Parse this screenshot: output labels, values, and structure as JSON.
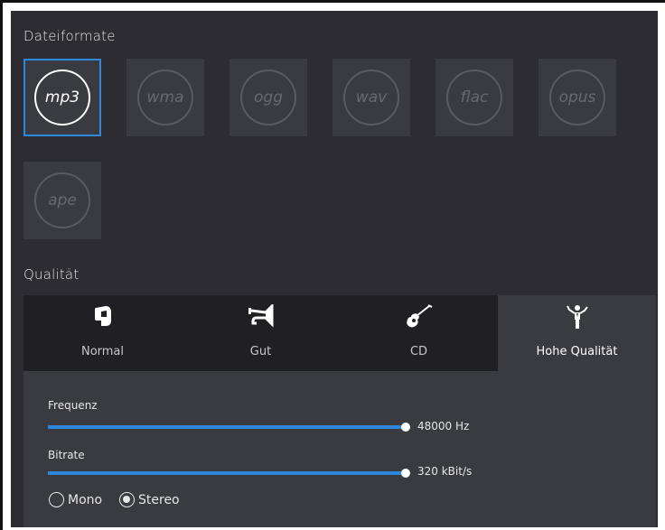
{
  "formats": {
    "title": "Dateiformate",
    "items": [
      {
        "label": "mp3",
        "selected": true
      },
      {
        "label": "wma",
        "selected": false
      },
      {
        "label": "ogg",
        "selected": false
      },
      {
        "label": "wav",
        "selected": false
      },
      {
        "label": "flac",
        "selected": false
      },
      {
        "label": "opus",
        "selected": false
      },
      {
        "label": "ape",
        "selected": false
      }
    ]
  },
  "quality": {
    "title": "Qualität",
    "tabs": [
      {
        "label": "Normal",
        "icon": "tape-icon"
      },
      {
        "label": "Gut",
        "icon": "trumpet-icon"
      },
      {
        "label": "CD",
        "icon": "guitar-icon"
      },
      {
        "label": "Hohe Qualität",
        "icon": "conductor-icon",
        "active": true
      }
    ]
  },
  "settings": {
    "frequency": {
      "label": "Frequenz",
      "value": "48000 Hz",
      "level": 1.0
    },
    "bitrate": {
      "label": "Bitrate",
      "value": "320 kBit/s",
      "level": 1.0
    },
    "channels": {
      "mono_label": "Mono",
      "stereo_label": "Stereo",
      "selected": "Stereo"
    }
  },
  "colors": {
    "accent": "#2f87dc",
    "background": "#2c2c32",
    "tile": "#3a3a41"
  }
}
